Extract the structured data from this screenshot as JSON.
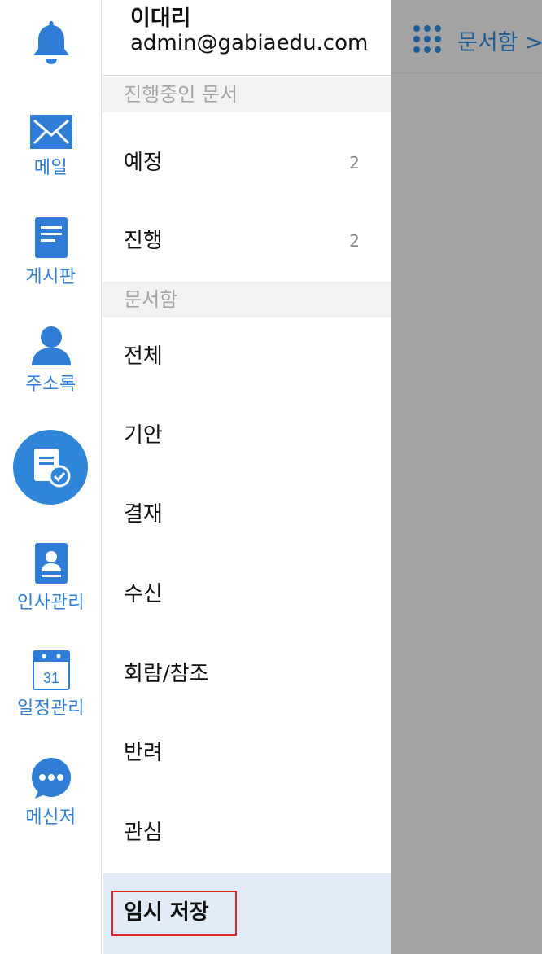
{
  "rail": {
    "items": [
      {
        "label": "",
        "icon": "bell-icon"
      },
      {
        "label": "메일",
        "icon": "mail-icon"
      },
      {
        "label": "게시판",
        "icon": "board-icon"
      },
      {
        "label": "주소록",
        "icon": "contact-icon"
      },
      {
        "label": "",
        "icon": "approval-icon"
      },
      {
        "label": "인사관리",
        "icon": "hr-icon"
      },
      {
        "label": "일정관리",
        "icon": "calendar-icon"
      },
      {
        "label": "메신저",
        "icon": "messenger-icon"
      }
    ],
    "calendar_day": "31",
    "accent": "#2f7dd6"
  },
  "profile": {
    "name": "이대리",
    "email": "admin@gabiaedu.com"
  },
  "sections": {
    "in_progress": {
      "title": "진행중인 문서",
      "items": [
        {
          "label": "예정",
          "count": "2"
        },
        {
          "label": "진행",
          "count": "2"
        }
      ]
    },
    "docbox": {
      "title": "문서함",
      "items": [
        {
          "label": "전체"
        },
        {
          "label": "기안"
        },
        {
          "label": "결재"
        },
        {
          "label": "수신"
        },
        {
          "label": "회람/참조"
        },
        {
          "label": "반려"
        },
        {
          "label": "관심"
        },
        {
          "label": "임시 저장",
          "active": true
        }
      ]
    }
  },
  "header": {
    "title": "문서함 >"
  }
}
